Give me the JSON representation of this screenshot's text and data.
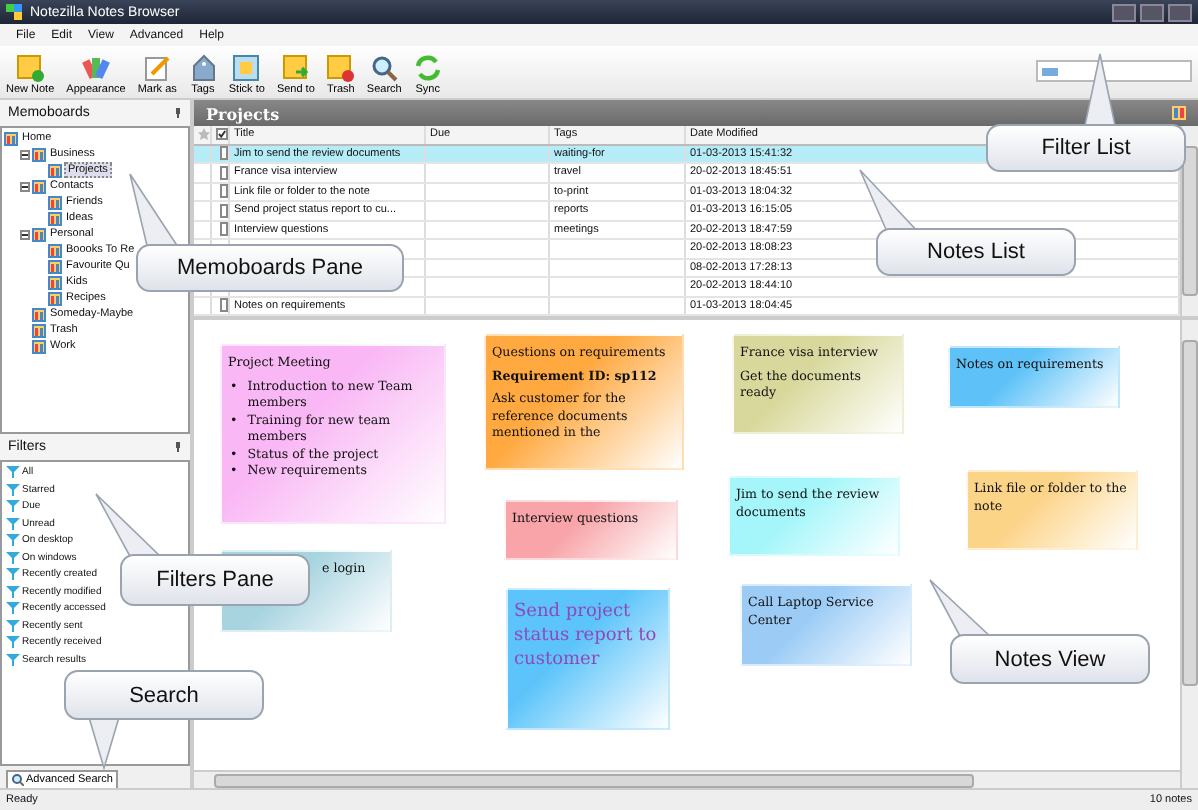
{
  "window": {
    "title": "Notezilla Notes Browser"
  },
  "menu": [
    "File",
    "Edit",
    "View",
    "Advanced",
    "Help"
  ],
  "toolbar": [
    {
      "label": "New Note",
      "kind": "new"
    },
    {
      "label": "Appearance",
      "kind": "appearance"
    },
    {
      "label": "Mark as",
      "kind": "mark"
    },
    {
      "label": "Tags",
      "kind": "tags"
    },
    {
      "label": "Stick to",
      "kind": "stick"
    },
    {
      "label": "Send to",
      "kind": "send"
    },
    {
      "label": "Trash",
      "kind": "trash"
    },
    {
      "label": "Search",
      "kind": "search"
    },
    {
      "label": "Sync",
      "kind": "sync"
    }
  ],
  "memoboards": {
    "title": "Memoboards",
    "tree": [
      {
        "label": "Home",
        "children": [
          {
            "label": "Business",
            "expanded": true,
            "children": [
              {
                "label": "Projects",
                "selected": true
              }
            ]
          },
          {
            "label": "Contacts",
            "expanded": true,
            "children": [
              {
                "label": "Friends",
                "selected": false
              },
              {
                "label": "Ideas",
                "selected": false
              }
            ]
          },
          {
            "label": "Personal",
            "expanded": true,
            "children": [
              {
                "label": "Boooks To Re",
                "selected": false
              },
              {
                "label": "Favourite Qu",
                "selected": false
              },
              {
                "label": "Kids",
                "selected": false
              },
              {
                "label": "Recipes",
                "selected": false
              }
            ]
          },
          {
            "label": "Someday-Maybe",
            "selected": false
          },
          {
            "label": "Trash",
            "selected": false
          },
          {
            "label": "Work",
            "selected": false
          }
        ]
      }
    ]
  },
  "filters": {
    "title": "Filters",
    "items": [
      "All",
      "Starred",
      "Due",
      "Unread",
      "On desktop",
      "On windows",
      "Recently created",
      "Recently modified",
      "Recently accessed",
      "Recently sent",
      "Recently received",
      "Search results"
    ]
  },
  "search_tab": {
    "label": "Advanced Search"
  },
  "projects": {
    "title": "Projects",
    "columns": [
      "Title",
      "Due",
      "Tags",
      "Date Modified"
    ],
    "rows": [
      {
        "title": "Jim to send the review documents",
        "tags": "waiting-for",
        "date": "01-03-2013 15:41:32",
        "selected": true,
        "checked": false
      },
      {
        "title": "France visa interview",
        "tags": "travel",
        "date": "20-02-2013 18:45:51",
        "selected": false,
        "checked": false
      },
      {
        "title": "Link file or folder to the note",
        "tags": "to-print",
        "date": "01-03-2013 18:04:32",
        "selected": false,
        "checked": false
      },
      {
        "title": "Send project status report to cu...",
        "tags": "reports",
        "date": "01-03-2013 16:15:05",
        "selected": false,
        "checked": false
      },
      {
        "title": "Interview questions",
        "tags": "meetings",
        "date": "20-02-2013 18:47:59",
        "selected": false,
        "checked": false
      },
      {
        "date": "20-02-2013 18:08:23",
        "selected": false
      },
      {
        "date": "08-02-2013 17:28:13",
        "selected": false
      },
      {
        "date": "20-02-2013 18:44:10",
        "selected": false
      },
      {
        "title": "Notes on requirements",
        "date": "01-03-2013 18:04:45",
        "selected": false,
        "checked": false
      }
    ]
  },
  "notes": [
    {
      "color": "#f9b8f5",
      "emphasis": false,
      "lines": [
        {
          "text": "Project Meeting",
          "bold": false
        }
      ],
      "bullet_marker": "•",
      "bullets": [
        "Introduction to new Team members",
        "Training for new team members",
        "Status of the project",
        "New requirements"
      ]
    },
    {
      "color": "#ffa940",
      "emphasis": false,
      "lines": [
        {
          "text": "Questions on requirements",
          "bold": false
        },
        {
          "text": "Requirement ID: sp112",
          "bold": true
        },
        {
          "text": "Ask customer for the reference documents mentioned in the",
          "bold": false
        }
      ]
    },
    {
      "color": "#d8d89c",
      "emphasis": false,
      "lines": [
        {
          "text": "France visa interview",
          "bold": false
        },
        {
          "text": "Get the documents ready",
          "bold": false
        }
      ]
    },
    {
      "color": "#5ec2f8",
      "emphasis": false,
      "lines": [
        {
          "text": "Notes on requirements",
          "bold": false
        }
      ]
    },
    {
      "color": "#f8a4a8",
      "emphasis": false,
      "lines": [
        {
          "text": "Interview questions",
          "bold": false
        }
      ]
    },
    {
      "color": "#a4f6fa",
      "emphasis": false,
      "lines": [
        {
          "text": "Jim to send the review documents",
          "bold": false
        }
      ]
    },
    {
      "color": "#fcd488",
      "emphasis": false,
      "lines": [
        {
          "text": "Link file or folder to the note",
          "bold": false
        }
      ]
    },
    {
      "color": "#a8d4e0",
      "emphasis": false,
      "lines": [
        {
          "text": "e login",
          "bold": false
        }
      ]
    },
    {
      "color": "#5cc4fa",
      "emphasis": true,
      "lines": [
        {
          "text": "Send project status report to customer",
          "bold": false
        }
      ]
    },
    {
      "color": "#9cccf6",
      "emphasis": false,
      "lines": [
        {
          "text": "Call Laptop Service Center",
          "bold": false
        }
      ]
    }
  ],
  "callouts": [
    "Memoboards Pane",
    "Filter List",
    "Notes List",
    "Filters Pane",
    "Search",
    "Notes View"
  ],
  "status_bar": {
    "left": "Ready",
    "right": "10 notes"
  }
}
